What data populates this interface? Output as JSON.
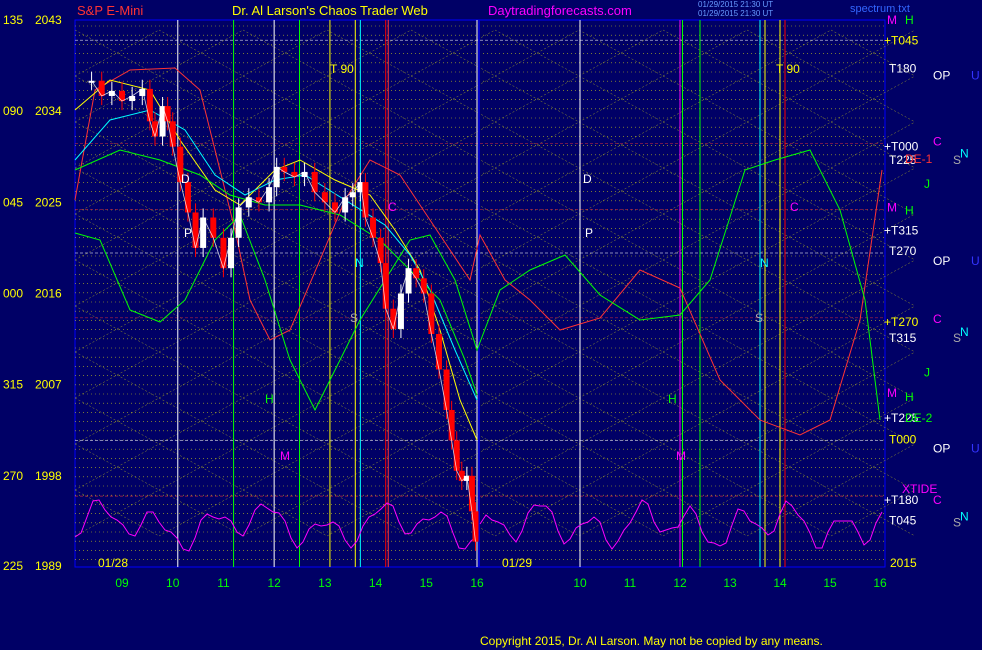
{
  "header": {
    "instrument": "S&P E-Mini",
    "title": "Dr. Al Larson's Chaos Trader Web",
    "site": "Daytradingforecasts.com",
    "stamp_line1": "01/29/2015 21:30 UT",
    "stamp_line2": "01/29/2015 21:30 UT",
    "corner": "spectrum.txt"
  },
  "footer": {
    "copyright": "Copyright 2015, Dr. Al Larson. May not be copied by any means."
  },
  "chart_data": {
    "type": "line",
    "title": "S&P E-Mini",
    "ylim": [
      1989,
      2043
    ],
    "y_ticks": [
      {
        "angle": "135",
        "price": "2043"
      },
      {
        "angle": "090",
        "price": "2034"
      },
      {
        "angle": "045",
        "price": "2025"
      },
      {
        "angle": "000",
        "price": "2016"
      },
      {
        "angle": "315",
        "price": "2007"
      },
      {
        "angle": "270",
        "price": "1998"
      },
      {
        "angle": "225",
        "price": "1989"
      }
    ],
    "x_ticks": [
      "09",
      "10",
      "11",
      "12",
      "13",
      "14",
      "15",
      "16",
      "10",
      "11",
      "12",
      "13",
      "14",
      "15",
      "16"
    ],
    "dates": [
      "01/28",
      "01/29"
    ],
    "year": "2015",
    "right_labels": [
      {
        "text": "M",
        "color": "#ff00ff",
        "price": 2043
      },
      {
        "text": "H",
        "color": "#00ff00",
        "price": 2043
      },
      {
        "text": "+T045",
        "color": "#ffff00",
        "price": 2041
      },
      {
        "text": "T180",
        "color": "#ffffff",
        "price": 2038.2
      },
      {
        "text": "OP",
        "color": "#ffffff",
        "price": 2037.5
      },
      {
        "text": "U",
        "color": "#3333ff",
        "price": 2037.5
      },
      {
        "text": "+T000",
        "color": "#ffffff",
        "price": 2030.5
      },
      {
        "text": "C",
        "color": "#ff00ff",
        "price": 2031
      },
      {
        "text": "T225",
        "color": "#ffffff",
        "price": 2029.2
      },
      {
        "text": "DE-1",
        "color": "#ff3333",
        "price": 2029.3
      },
      {
        "text": "S",
        "color": "#aaaaaa",
        "price": 2029.2
      },
      {
        "text": "N",
        "color": "#00ffff",
        "price": 2029.8
      },
      {
        "text": "J",
        "color": "#00ff00",
        "price": 2026.8
      },
      {
        "text": "M",
        "color": "#ff00ff",
        "price": 2024.5
      },
      {
        "text": "H",
        "color": "#00ff00",
        "price": 2024.2
      },
      {
        "text": "+T315",
        "color": "#ffffff",
        "price": 2022.2
      },
      {
        "text": "T270",
        "color": "#ffffff",
        "price": 2020.2
      },
      {
        "text": "OP",
        "color": "#ffffff",
        "price": 2019.2
      },
      {
        "text": "U",
        "color": "#3333ff",
        "price": 2019.2
      },
      {
        "text": "+T270",
        "color": "#ffff00",
        "price": 2013.2
      },
      {
        "text": "C",
        "color": "#ff00ff",
        "price": 2013.5
      },
      {
        "text": "T315",
        "color": "#ffffff",
        "price": 2011.6
      },
      {
        "text": "S",
        "color": "#aaaaaa",
        "price": 2011.6
      },
      {
        "text": "N",
        "color": "#00ffff",
        "price": 2012.2
      },
      {
        "text": "J",
        "color": "#00ff00",
        "price": 2008.2
      },
      {
        "text": "M",
        "color": "#ff00ff",
        "price": 2006.2
      },
      {
        "text": "H",
        "color": "#00ff00",
        "price": 2005.8
      },
      {
        "text": "+T225",
        "color": "#ffffff",
        "price": 2003.7
      },
      {
        "text": "DE-2",
        "color": "#00ff00",
        "price": 2003.7
      },
      {
        "text": "T000",
        "color": "#ffff00",
        "price": 2001.6
      },
      {
        "text": "OP",
        "color": "#ffffff",
        "price": 2000.7
      },
      {
        "text": "U",
        "color": "#3333ff",
        "price": 2000.7
      },
      {
        "text": "XTIDE",
        "color": "#ff00ff",
        "price": 1996.7
      },
      {
        "text": "+T180",
        "color": "#ffffff",
        "price": 1995.6
      },
      {
        "text": "C",
        "color": "#ff00ff",
        "price": 1995.6
      },
      {
        "text": "T045",
        "color": "#ffffff",
        "price": 1993.6
      },
      {
        "text": "S",
        "color": "#aaaaaa",
        "price": 1993.4
      },
      {
        "text": "N",
        "color": "#00ffff",
        "price": 1994
      }
    ],
    "in_chart_labels": [
      {
        "text": "T 90",
        "color": "#ffff00"
      },
      {
        "text": "T 90",
        "color": "#ffff00"
      },
      {
        "text": "D",
        "color": "#ffffff"
      },
      {
        "text": "P",
        "color": "#ffffff"
      },
      {
        "text": "D",
        "color": "#ffffff"
      },
      {
        "text": "P",
        "color": "#ffffff"
      },
      {
        "text": "M",
        "color": "#ff00ff"
      },
      {
        "text": "M",
        "color": "#ff00ff"
      },
      {
        "text": "H",
        "color": "#00ff00"
      },
      {
        "text": "H",
        "color": "#00ff00"
      },
      {
        "text": "N",
        "color": "#00ffff"
      },
      {
        "text": "N",
        "color": "#00ffff"
      },
      {
        "text": "S",
        "color": "#aaaaaa"
      },
      {
        "text": "S",
        "color": "#aaaaaa"
      },
      {
        "text": "C",
        "color": "#ff00ff"
      },
      {
        "text": "C",
        "color": "#ff00ff"
      }
    ],
    "price_series": [
      {
        "t": 8.4,
        "p": 2037.0
      },
      {
        "t": 8.6,
        "p": 2035.5
      },
      {
        "t": 8.8,
        "p": 2036.0
      },
      {
        "t": 9.0,
        "p": 2035.0
      },
      {
        "t": 9.2,
        "p": 2035.5
      },
      {
        "t": 9.4,
        "p": 2036.2
      },
      {
        "t": 9.55,
        "p": 2033.0
      },
      {
        "t": 9.65,
        "p": 2031.5
      },
      {
        "t": 9.8,
        "p": 2034.5
      },
      {
        "t": 9.9,
        "p": 2033.0
      },
      {
        "t": 10.0,
        "p": 2030.5
      },
      {
        "t": 10.15,
        "p": 2027.0
      },
      {
        "t": 10.3,
        "p": 2024.0
      },
      {
        "t": 10.45,
        "p": 2020.5
      },
      {
        "t": 10.6,
        "p": 2023.5
      },
      {
        "t": 10.8,
        "p": 2021.5
      },
      {
        "t": 11.0,
        "p": 2018.5
      },
      {
        "t": 11.15,
        "p": 2021.5
      },
      {
        "t": 11.3,
        "p": 2024.5
      },
      {
        "t": 11.5,
        "p": 2025.5
      },
      {
        "t": 11.7,
        "p": 2025.0
      },
      {
        "t": 11.9,
        "p": 2026.5
      },
      {
        "t": 12.05,
        "p": 2028.5
      },
      {
        "t": 12.2,
        "p": 2028.0
      },
      {
        "t": 12.4,
        "p": 2027.5
      },
      {
        "t": 12.6,
        "p": 2028.0
      },
      {
        "t": 12.8,
        "p": 2026.0
      },
      {
        "t": 13.0,
        "p": 2025.0
      },
      {
        "t": 13.2,
        "p": 2024.0
      },
      {
        "t": 13.4,
        "p": 2025.5
      },
      {
        "t": 13.55,
        "p": 2026.0
      },
      {
        "t": 13.7,
        "p": 2027.0
      },
      {
        "t": 13.8,
        "p": 2023.5
      },
      {
        "t": 13.95,
        "p": 2021.5
      },
      {
        "t": 14.1,
        "p": 2019.0
      },
      {
        "t": 14.2,
        "p": 2014.5
      },
      {
        "t": 14.35,
        "p": 2012.5
      },
      {
        "t": 14.5,
        "p": 2016.0
      },
      {
        "t": 14.65,
        "p": 2018.5
      },
      {
        "t": 14.8,
        "p": 2017.5
      },
      {
        "t": 14.95,
        "p": 2016.0
      },
      {
        "t": 15.1,
        "p": 2012.0
      },
      {
        "t": 15.25,
        "p": 2008.5
      },
      {
        "t": 15.4,
        "p": 2004.5
      },
      {
        "t": 15.5,
        "p": 2001.5
      },
      {
        "t": 15.6,
        "p": 1998.5
      },
      {
        "t": 15.7,
        "p": 1997.5
      },
      {
        "t": 15.8,
        "p": 1998.0
      },
      {
        "t": 15.9,
        "p": 1994.5
      },
      {
        "t": 15.97,
        "p": 1991.5
      }
    ],
    "colors": {
      "background": "#000066",
      "grid": "#ffff00",
      "price_up": "#ffffff",
      "price_down": "#ff0000",
      "moving_avg_1": "#ffff00",
      "moving_avg_2": "#00ffff",
      "moving_avg_3": "#00ff00",
      "forecast_red": "#ff3333",
      "forecast_green": "#00ff00",
      "oscillator": "#ff00ff"
    }
  }
}
